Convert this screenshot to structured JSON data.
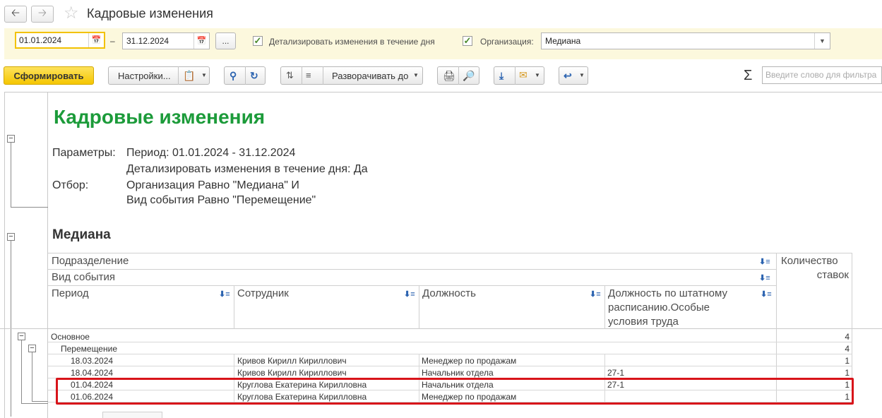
{
  "window": {
    "title": "Кадровые изменения",
    "back_icon": "arrow-left-icon",
    "forward_icon": "arrow-right-icon",
    "favorite_icon": "star-icon"
  },
  "params": {
    "date_from": "01.01.2024",
    "date_to": "31.12.2024",
    "dash": "–",
    "more_label": "...",
    "detail_checkbox_label": "Детализировать изменения в течение дня",
    "detail_checked": true,
    "org_checked": true,
    "org_label": "Организация:",
    "org_value": "Медиана"
  },
  "toolbar": {
    "generate_label": "Сформировать",
    "settings_label": "Настройки...",
    "expand_label": "Разворачивать до",
    "filter_placeholder": "Введите слово для фильтра",
    "sigma": "Σ"
  },
  "report": {
    "title": "Кадровые изменения",
    "params_label": "Параметры:",
    "param_period": "Период: 01.01.2024 - 31.12.2024",
    "param_detail": "Детализировать изменения в течение дня: Да",
    "filter_label": "Отбор:",
    "filter_org": "Организация Равно \"Медиана\" И",
    "filter_event": "Вид события Равно \"Перемещение\"",
    "org_name": "Медиана",
    "headers": {
      "subdivision": "Подразделение",
      "event_type": "Вид события",
      "period": "Период",
      "employee": "Сотрудник",
      "position": "Должность",
      "staff_position_l1": "Должность по штатному",
      "staff_position_l2": "расписанию.Особые",
      "staff_position_l3": "условия труда",
      "rates_l1": "Количество",
      "rates_l2": "ставок"
    },
    "group_main": {
      "label": "Основное",
      "count": "4"
    },
    "group_move": {
      "label": "Перемещение",
      "count": "4"
    },
    "rows": [
      {
        "period": "18.03.2024",
        "employee": "Кривов Кирилл Кириллович",
        "position": "Менеджер по продажам",
        "staff": "",
        "count": "1"
      },
      {
        "period": "18.04.2024",
        "employee": "Кривов Кирилл Кириллович",
        "position": "Начальник отдела",
        "staff": "27-1",
        "count": "1"
      },
      {
        "period": "01.04.2024",
        "employee": "Круглова Екатерина Кирилловна",
        "position": "Начальник отдела",
        "staff": "27-1",
        "count": "1"
      },
      {
        "period": "01.06.2024",
        "employee": "Круглова Екатерина Кирилловна",
        "position": "Менеджер по продажам",
        "staff": "",
        "count": "1"
      }
    ]
  },
  "colors": {
    "accent_green": "#1c9b3a",
    "primary_yellow": "#f5c600",
    "highlight_red": "#d8141a"
  }
}
